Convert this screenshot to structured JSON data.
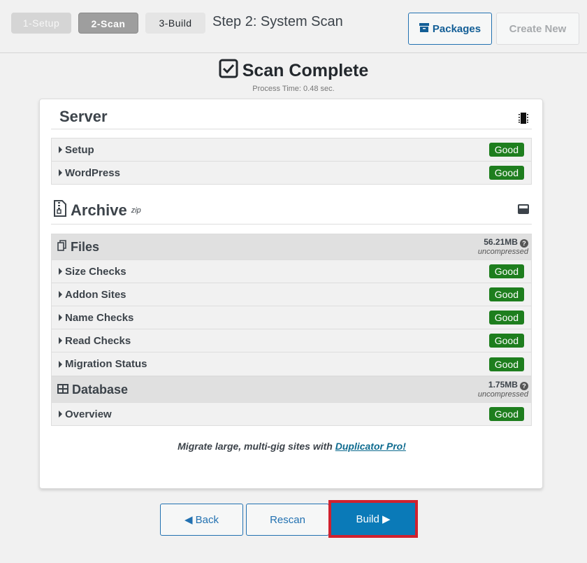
{
  "steps": [
    {
      "label": "1-Setup",
      "state": "done"
    },
    {
      "label": "2-Scan",
      "state": "active"
    },
    {
      "label": "3-Build",
      "state": "pending"
    }
  ],
  "step_title": "Step 2: System Scan",
  "header_buttons": {
    "packages": {
      "label": "Packages",
      "icon": "archive-box-icon"
    },
    "create_new": {
      "label": "Create New",
      "disabled": true
    }
  },
  "hero": {
    "title": "Scan Complete",
    "icon": "checkbox-checked-icon",
    "process_time": "Process Time: 0.48 sec."
  },
  "server": {
    "title": "Server",
    "icon": "microchip-icon",
    "rows": [
      {
        "label": "Setup",
        "status": "Good"
      },
      {
        "label": "WordPress",
        "status": "Good"
      }
    ]
  },
  "archive": {
    "title": "Archive",
    "format": "zip",
    "icon": "file-zip-icon",
    "right_icon": "hdd-icon",
    "files": {
      "title": "Files",
      "size": "56.21MB",
      "size_note": "uncompressed",
      "rows": [
        {
          "label": "Size Checks",
          "status": "Good"
        },
        {
          "label": "Addon Sites",
          "status": "Good"
        },
        {
          "label": "Name Checks",
          "status": "Good"
        },
        {
          "label": "Read Checks",
          "status": "Good"
        },
        {
          "label": "Migration Status",
          "status": "Good"
        }
      ]
    },
    "database": {
      "title": "Database",
      "size": "1.75MB",
      "size_note": "uncompressed",
      "rows": [
        {
          "label": "Overview",
          "status": "Good"
        }
      ]
    }
  },
  "promo": {
    "text": "Migrate large, multi-gig sites with ",
    "link": "Duplicator Pro!"
  },
  "footer": {
    "back": "◀ Back",
    "rescan": "Rescan",
    "build": "Build ▶"
  },
  "colors": {
    "good_badge": "#1e7e1e",
    "primary": "#0a7ab8",
    "highlight": "#d0212e"
  }
}
